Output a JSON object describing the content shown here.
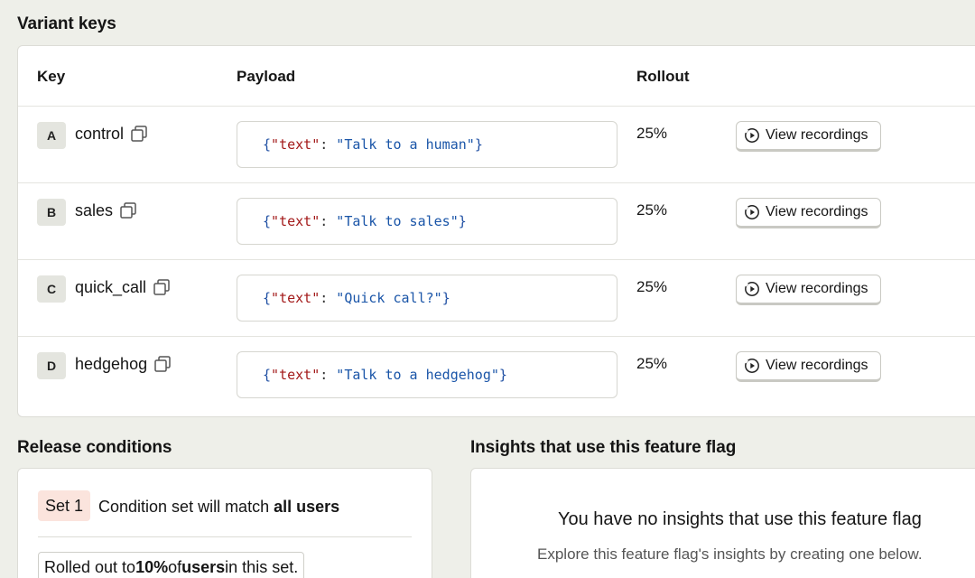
{
  "variants": {
    "title": "Variant keys",
    "headers": {
      "key": "Key",
      "payload": "Payload",
      "rollout": "Rollout"
    },
    "rows": [
      {
        "letter": "A",
        "key": "control",
        "payload_key": "text",
        "payload_value": "Talk to a human",
        "rollout": "25%",
        "recordings_label": "View recordings"
      },
      {
        "letter": "B",
        "key": "sales",
        "payload_key": "text",
        "payload_value": "Talk to sales",
        "rollout": "25%",
        "recordings_label": "View recordings"
      },
      {
        "letter": "C",
        "key": "quick_call",
        "payload_key": "text",
        "payload_value": "Quick call?",
        "rollout": "25%",
        "recordings_label": "View recordings"
      },
      {
        "letter": "D",
        "key": "hedgehog",
        "payload_key": "text",
        "payload_value": "Talk to a hedgehog",
        "rollout": "25%",
        "recordings_label": "View recordings"
      }
    ]
  },
  "release": {
    "title": "Release conditions",
    "set_label": "Set 1",
    "condition_prefix": "Condition set will match ",
    "condition_bold": "all users",
    "rolled_prefix": "Rolled out to ",
    "rolled_percent": "10%",
    "rolled_mid": " of ",
    "rolled_users": "users",
    "rolled_suffix": " in this set."
  },
  "insights": {
    "title": "Insights that use this feature flag",
    "empty_title": "You have no insights that use this feature flag",
    "empty_desc": "Explore this feature flag's insights by creating one below."
  },
  "icons": {
    "copy": "copy-icon",
    "recordings": "play-circle-icon"
  },
  "colors": {
    "background": "#eeefe9",
    "set_badge": "#fbe4dd",
    "json_key": "#a31a1a",
    "json_value": "#1a55a8"
  }
}
